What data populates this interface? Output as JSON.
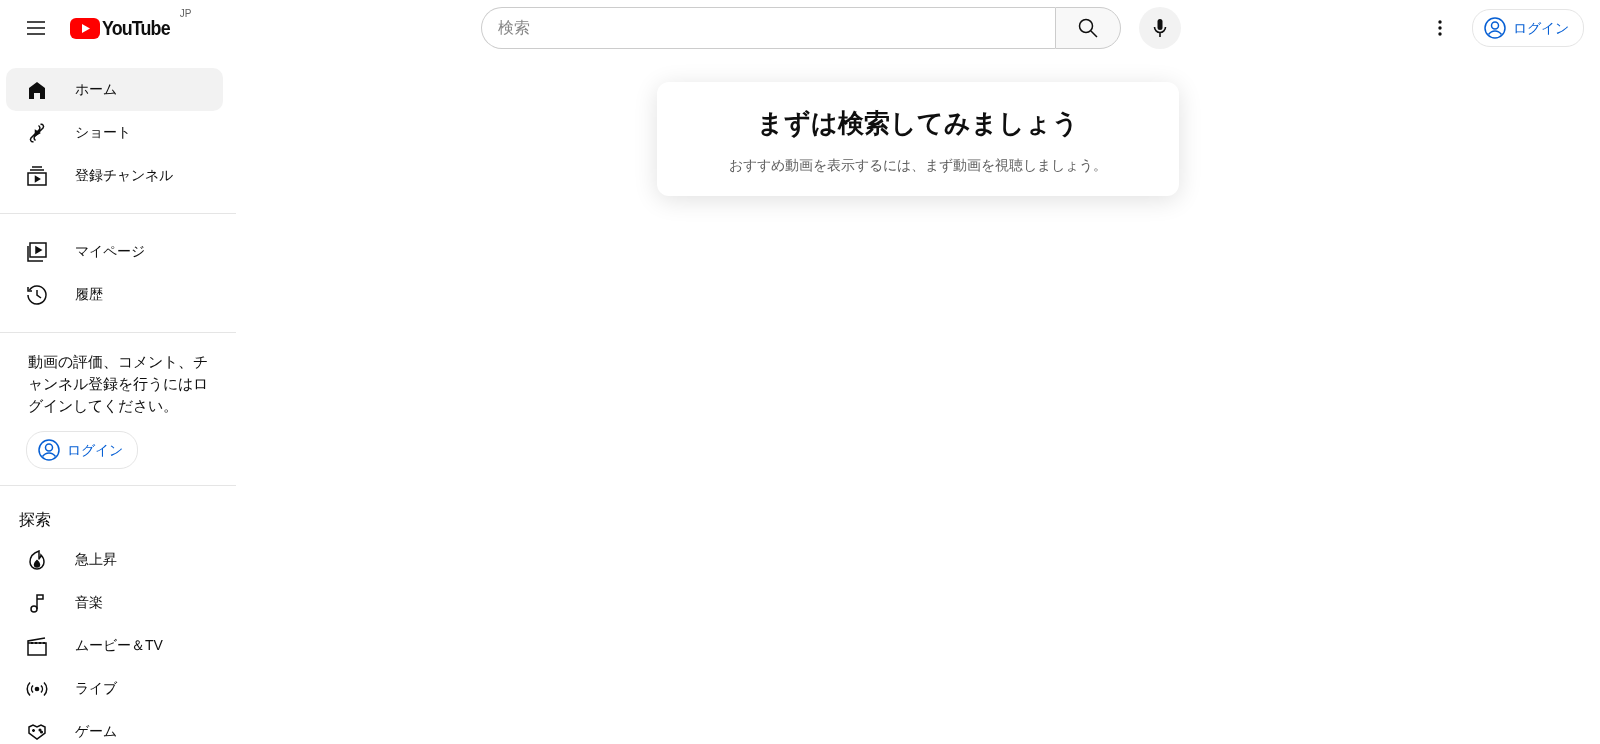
{
  "header": {
    "logo_text": "YouTube",
    "region": "JP",
    "search": {
      "placeholder": "検索"
    },
    "login_button": "ログイン"
  },
  "sidebar": {
    "main_items": [
      {
        "label": "ホーム",
        "selected": true
      },
      {
        "label": "ショート",
        "selected": false
      },
      {
        "label": "登録チャンネル",
        "selected": false
      }
    ],
    "you_items": [
      {
        "label": "マイページ",
        "selected": false
      },
      {
        "label": "履歴",
        "selected": false
      }
    ],
    "login_prompt": "動画の評価、コメント、チャンネル登録を行うにはログインしてください。",
    "login_button": "ログイン",
    "explore_heading": "探索",
    "explore_items": [
      {
        "label": "急上昇",
        "selected": false
      },
      {
        "label": "音楽",
        "selected": false
      },
      {
        "label": "ムービー＆TV",
        "selected": false
      },
      {
        "label": "ライブ",
        "selected": false
      },
      {
        "label": "ゲーム",
        "selected": false
      }
    ]
  },
  "empty_state": {
    "title": "まずは検索してみましょう",
    "message": "おすすめ動画を表示するには、まず動画を視聴しましょう。"
  }
}
